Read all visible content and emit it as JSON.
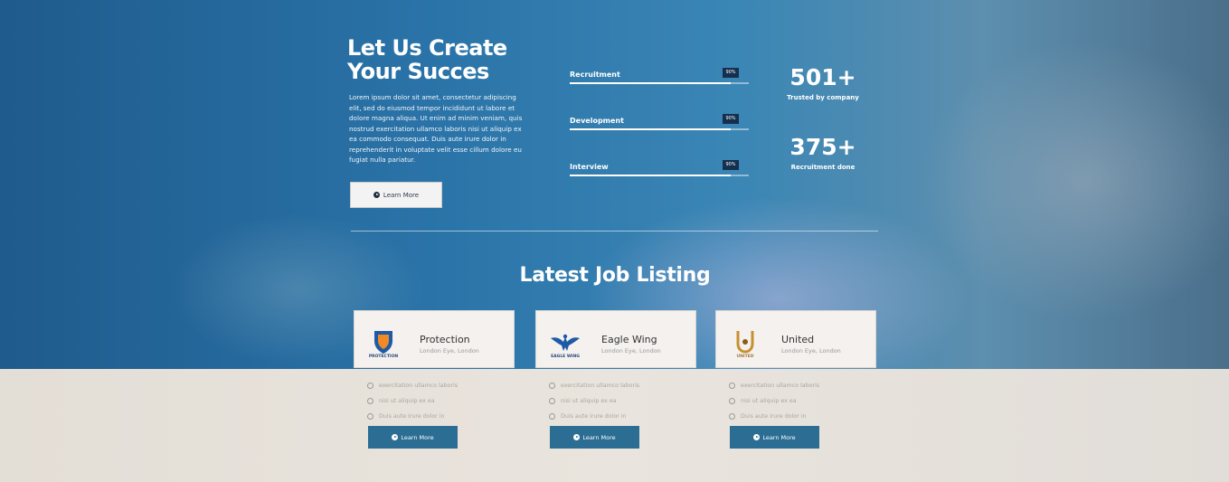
{
  "hero": {
    "title_line1": "Let Us Create",
    "title_line2": "Your Succes",
    "body": "Lorem ipsum dolor sit amet, consectetur adipiscing elit, sed do eiusmod tempor incididunt ut labore et dolore magna aliqua. Ut enim ad minim veniam, quis nostrud exercitation ullamco laboris nisi ut aliquip ex ea commodo consequat. Duis aute irure dolor in reprehenderit in voluptate velit esse cillum dolore eu fugiat nulla pariatur.",
    "button_label": "Learn More"
  },
  "skills": [
    {
      "label": "Recruitment",
      "percent_label": "90%",
      "value": 0.9
    },
    {
      "label": "Development",
      "percent_label": "90%",
      "value": 0.9
    },
    {
      "label": "Interview",
      "percent_label": "90%",
      "value": 0.9
    }
  ],
  "stats": [
    {
      "number": "501+",
      "label": "Trusted by company"
    },
    {
      "number": "375+",
      "label": "Recruitment done"
    }
  ],
  "listing": {
    "title": "Latest Job Listing",
    "jobs": [
      {
        "company": "Protection",
        "location": "London Eye, London",
        "logo_icon": "shield-icon",
        "logo_caption": "PROTECTION",
        "features": [
          "exercitation ullamco laboris",
          "nisi ut aliquip ex ea",
          "Duis aute irure dolor in"
        ],
        "button_label": "Learn More"
      },
      {
        "company": "Eagle Wing",
        "location": "London Eye, London",
        "logo_icon": "eagle-icon",
        "logo_caption": "EAGLE WING",
        "features": [
          "exercitation ullamco laboris",
          "nisi ut aliquip ex ea",
          "Duis aute irure dolor in"
        ],
        "button_label": "Learn More"
      },
      {
        "company": "United",
        "location": "London Eye, London",
        "logo_icon": "united-u-icon",
        "logo_caption": "UNITED",
        "features": [
          "exercitation ullamco laboris",
          "nisi ut aliquip ex ea",
          "Duis aute irure dolor in"
        ],
        "button_label": "Learn More"
      }
    ]
  },
  "colors": {
    "hero_blue": "#2a73a8",
    "badge_navy": "#15304f",
    "button_blue": "#2b6d93",
    "card_bg": "#f4f1ef"
  }
}
